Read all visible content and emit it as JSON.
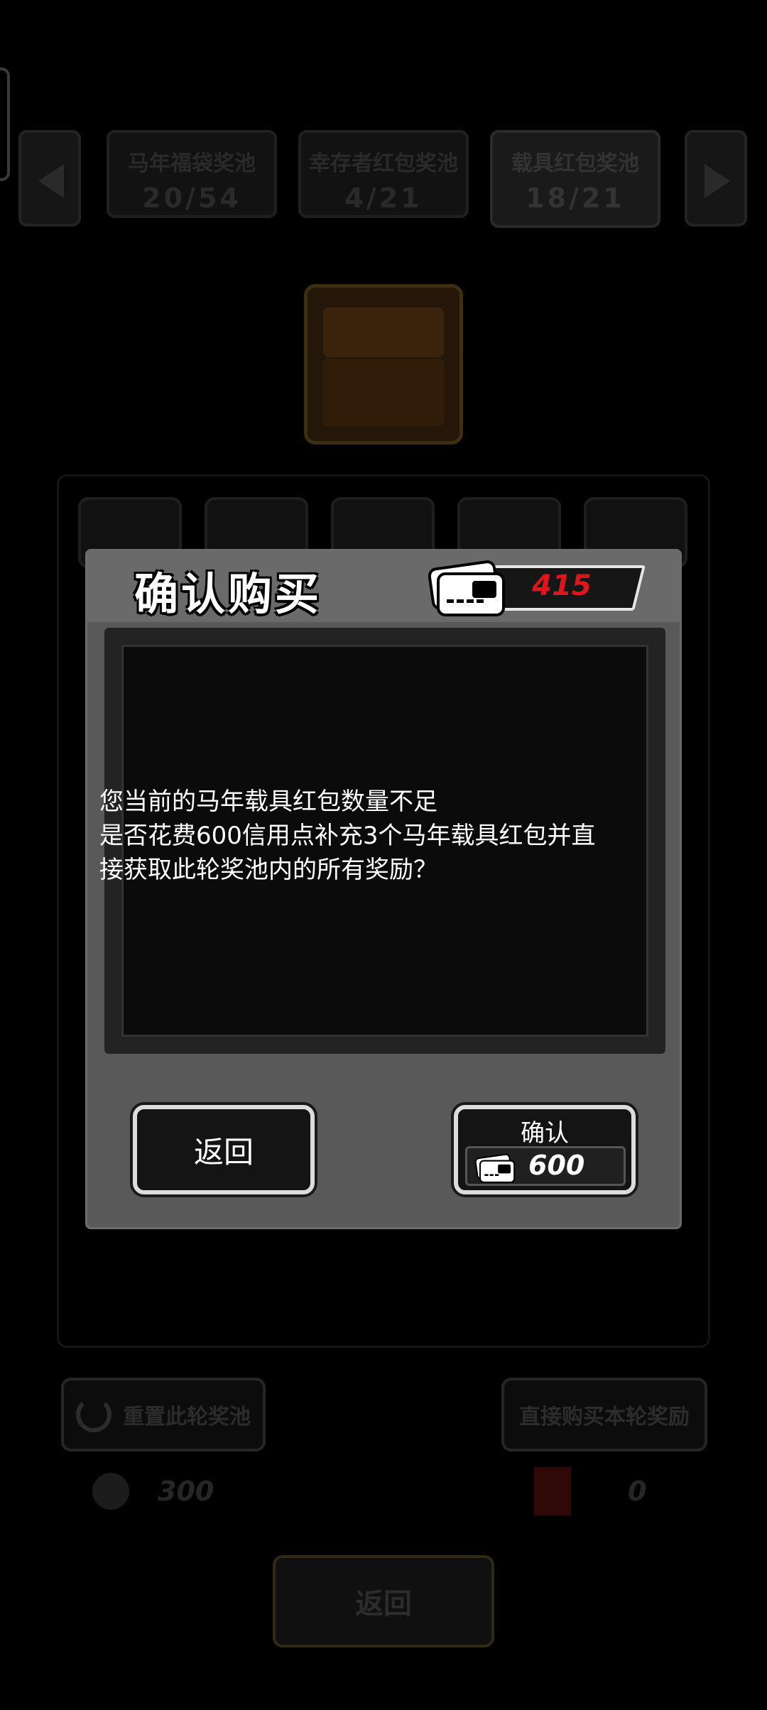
{
  "pools": [
    {
      "name": "马年福袋奖池",
      "count": "20/54"
    },
    {
      "name": "幸存者红包奖池",
      "count": "4/21"
    },
    {
      "name": "载具红包奖池",
      "count": "18/21"
    }
  ],
  "background": {
    "reset_label": "重置此轮奖池",
    "buy_direct_label": "直接购买本轮奖励",
    "reset_cost": "300",
    "envelope_count": "0",
    "back_label": "返回"
  },
  "modal": {
    "title": "确认购买",
    "currency_balance": "415",
    "message_lines": [
      "您当前的马年载具红包数量不足",
      "是否花费600信用点补充3个马年载具红包并直",
      "接获取此轮奖池内的所有奖励？"
    ],
    "back_label": "返回",
    "confirm_label": "确认",
    "confirm_price": "600"
  },
  "colors": {
    "balance_red": "#e0141c",
    "modal_bg": "#595959",
    "button_border": "#dcdcdc"
  }
}
